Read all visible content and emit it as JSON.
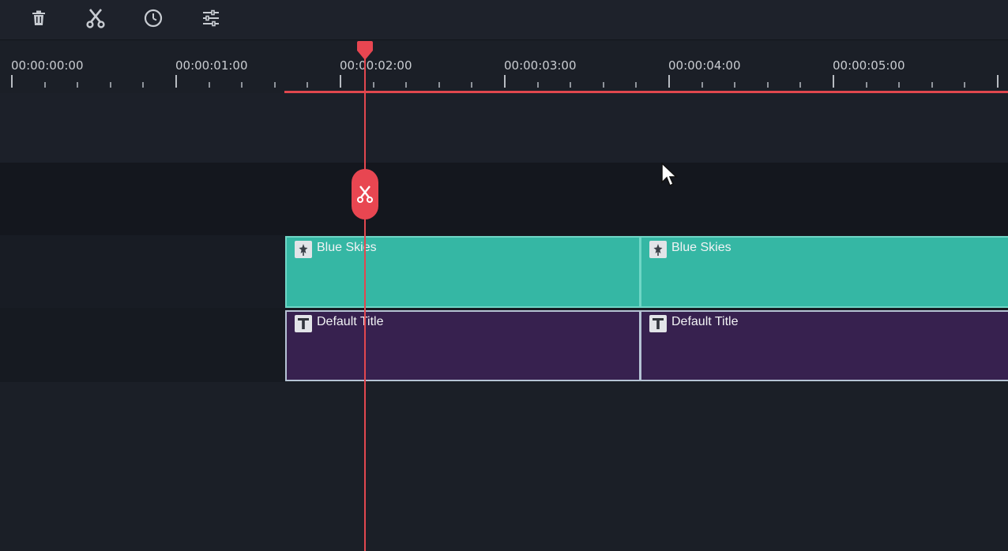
{
  "toolbar": {
    "icons": [
      "trash-icon",
      "scissors-icon",
      "clock-icon",
      "sliders-icon"
    ]
  },
  "ruler": {
    "labels": [
      "00:00:00:00",
      "00:00:01:00",
      "00:00:02:00",
      "00:00:03:00",
      "00:00:04:00",
      "00:00:05:00"
    ]
  },
  "tracks": {
    "audio": {
      "clips": [
        {
          "label": "Blue Skies",
          "icon": "music-note-icon"
        },
        {
          "label": "Blue Skies",
          "icon": "music-note-icon"
        }
      ]
    },
    "title": {
      "clips": [
        {
          "label": "Default Title",
          "icon": "text-t-icon"
        },
        {
          "label": "Default Title",
          "icon": "text-t-icon"
        }
      ]
    }
  },
  "colors": {
    "accent": "#e2474f",
    "audio_clip": "#35b7a4",
    "title_clip": "#37214f",
    "background": "#1b1f27"
  }
}
